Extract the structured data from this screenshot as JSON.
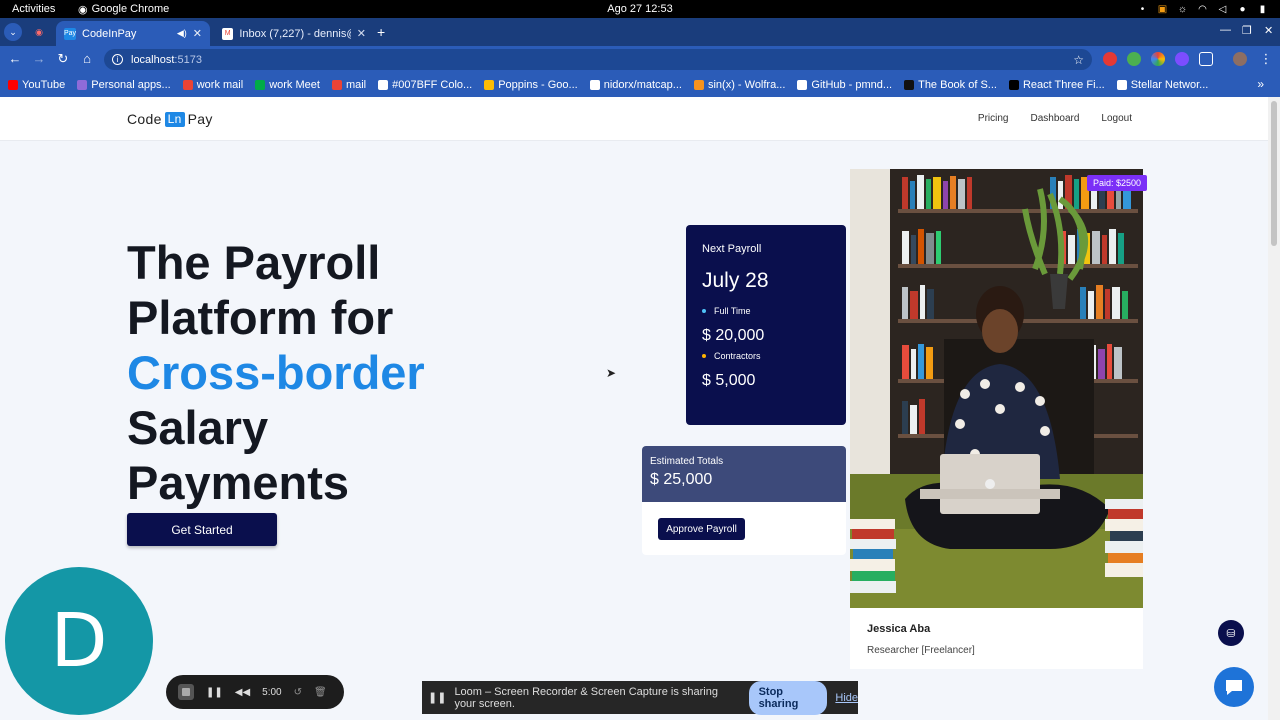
{
  "os_bar": {
    "activities": "Activities",
    "app_name": "Google Chrome",
    "clock": "Ago 27  12:53"
  },
  "browser": {
    "tabs": [
      {
        "title": "CodeInPay",
        "favicon": "Pay",
        "active": true
      },
      {
        "title": "Inbox (7,227) - dennis@...",
        "favicon": "M",
        "active": false
      }
    ],
    "new_tab": "+",
    "address": {
      "host": "localhost",
      "port": ":5173"
    },
    "bookmarks": [
      {
        "label": "YouTube",
        "color": "#ff0000"
      },
      {
        "label": "Personal apps...",
        "color": "#8e6bd9"
      },
      {
        "label": "work mail",
        "color": "#ea4335"
      },
      {
        "label": "work Meet",
        "color": "#00ac47"
      },
      {
        "label": "mail",
        "color": "#ea4335"
      },
      {
        "label": "#007BFF Colo...",
        "color": "#ffffff"
      },
      {
        "label": "Poppins - Goo...",
        "color": "#fbbc04"
      },
      {
        "label": "nidorx/matcap...",
        "color": "#ffffff"
      },
      {
        "label": "sin(x) - Wolfra...",
        "color": "#f7931e"
      },
      {
        "label": "GitHub - pmnd...",
        "color": "#ffffff"
      },
      {
        "label": "The Book of S...",
        "color": "#111111"
      },
      {
        "label": "React Three Fi...",
        "color": "#000000"
      },
      {
        "label": "Stellar Networ...",
        "color": "#ffffff"
      }
    ],
    "bookmarks_more": "»"
  },
  "site": {
    "logo": {
      "pre": "Code",
      "mid": "Ln",
      "post": "Pay"
    },
    "nav": [
      "Pricing",
      "Dashboard",
      "Logout"
    ],
    "hero": {
      "line1": "The Payroll",
      "line2": "Platform for",
      "accent": "Cross-border",
      "line4": "Salary",
      "line5": "Payments"
    },
    "cta": "Get Started",
    "payroll": {
      "label": "Next Payroll",
      "date": "July 28",
      "items": [
        {
          "label": "Full Time",
          "amount": "$ 20,000",
          "dot_color": "#4fc3f7"
        },
        {
          "label": "Contractors",
          "amount": "$ 5,000",
          "dot_color": "#ffb300"
        }
      ]
    },
    "totals": {
      "label": "Estimated Totals",
      "value": "$ 25,000",
      "button": "Approve Payroll"
    },
    "employee": {
      "paid_badge": "Paid: $2500",
      "name": "Jessica Aba",
      "role": "Researcher [Freelancer]"
    }
  },
  "overlays": {
    "avatar_letter": "D",
    "loom_timer": "5:00",
    "share_text": "Loom – Screen Recorder & Screen Capture is sharing your screen.",
    "stop_sharing": "Stop sharing",
    "hide": "Hide"
  },
  "colors": {
    "brand_dark": "#0a0f4d",
    "accent": "#1e88e5",
    "badge": "#7b2ff7"
  }
}
